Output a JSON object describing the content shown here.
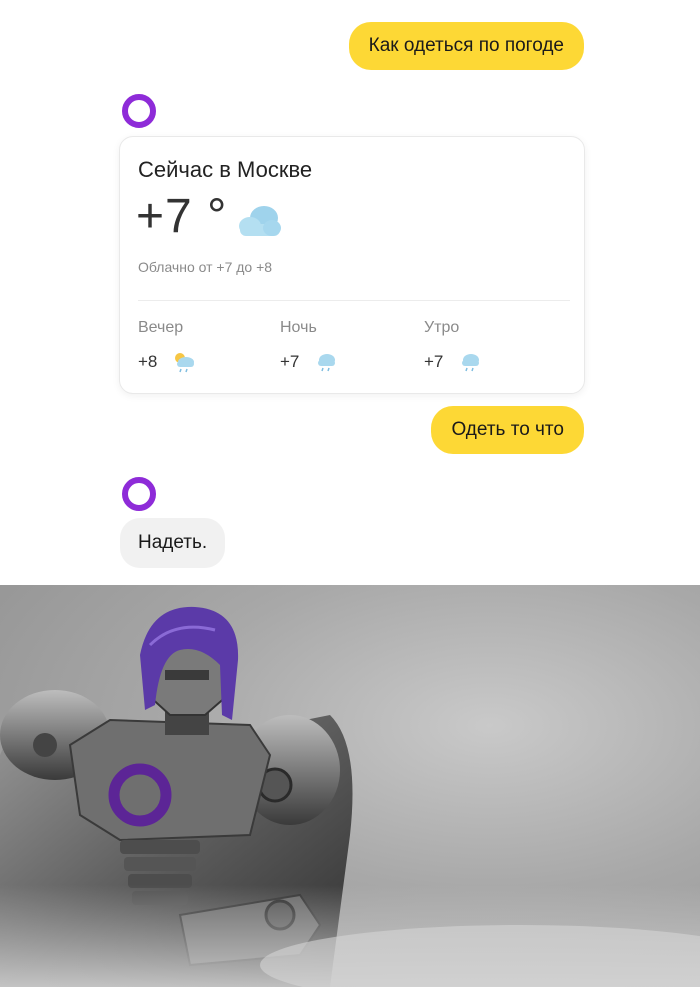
{
  "chat": {
    "user_message_1": "Как одеться по погоде",
    "weather": {
      "title": "Сейчас в Москве",
      "temperature": "+7 °",
      "description": "Облачно от +7 до +8",
      "forecast": [
        {
          "label": "Вечер",
          "temp": "+8",
          "icon": "partly-cloudy-rain-icon"
        },
        {
          "label": "Ночь",
          "temp": "+7",
          "icon": "cloud-rain-icon"
        },
        {
          "label": "Утро",
          "temp": "+7",
          "icon": "cloud-rain-icon"
        }
      ]
    },
    "user_message_2": "Одеть то что",
    "assistant_reply": "Надеть."
  },
  "colors": {
    "user_bubble": "#fdd835",
    "assistant_logo": "#8e2bd8",
    "assistant_bubble": "#f1f1f1"
  },
  "illustration": {
    "subject": "grayscale robot with purple hair and purple Alice ring on chest"
  }
}
